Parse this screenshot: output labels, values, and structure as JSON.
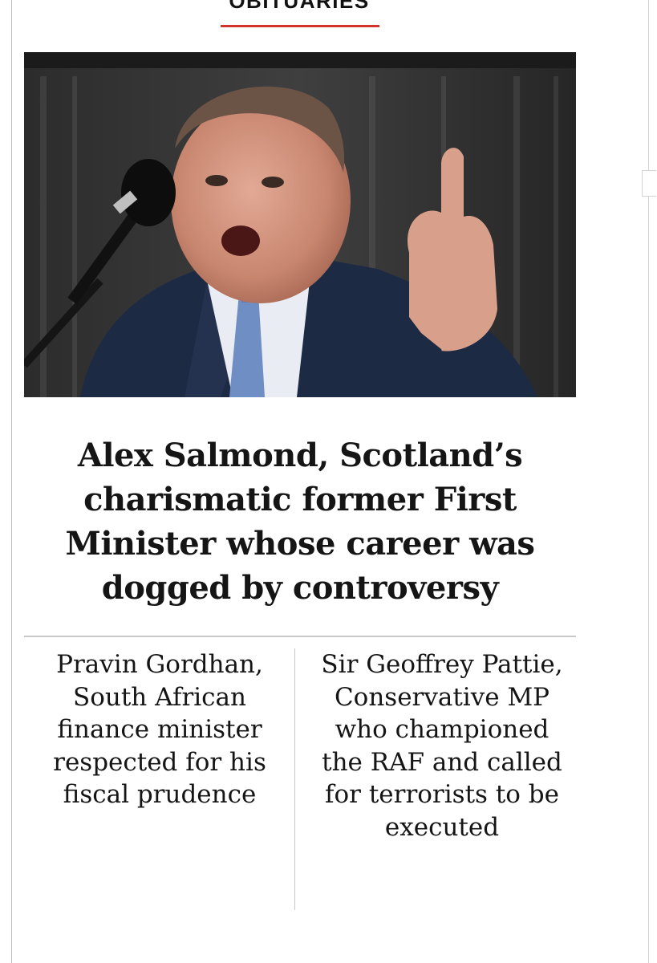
{
  "section": {
    "label": "OBITUARIES",
    "accent_color": "#d0342c"
  },
  "hero": {
    "image_icon": "photo-speaker-at-microphone"
  },
  "main_story": {
    "headline": "Alex Salmond, Scotland’s charismatic former First Minister whose career was dogged by controversy"
  },
  "related": [
    {
      "headline": "Pravin Gordhan, South African finance minister respected for his fiscal prudence"
    },
    {
      "headline": "Sir Geoffrey Pattie, Conservative MP who championed the RAF and called for terrorists to be executed"
    }
  ]
}
